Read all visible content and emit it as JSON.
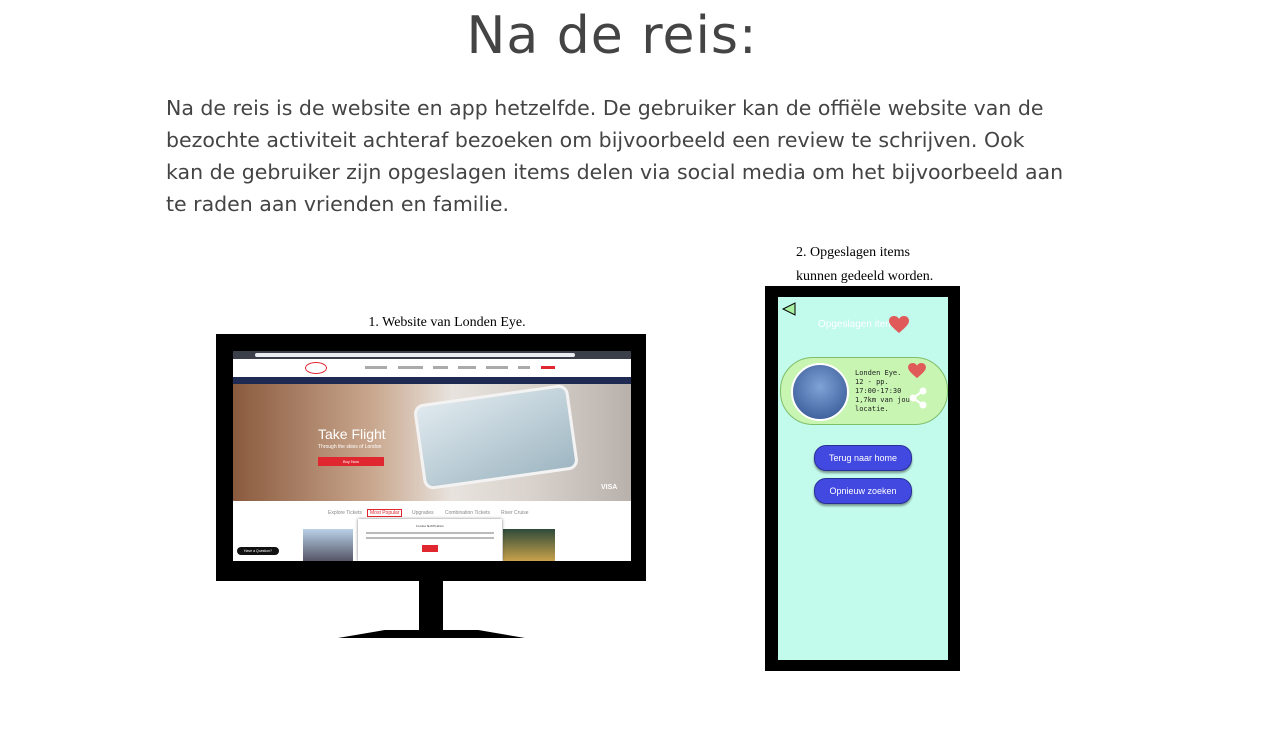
{
  "page": {
    "title": "Na de reis:",
    "intro": "Na de reis is de website en app hetzelfde. De gebruiker kan de offiële website van de bezochte activiteit achteraf bezoeken om bijvoorbeeld een review te schrijven. Ook kan de gebruiker zijn opgeslagen items delen via social media om het bijvoorbeeld aan te raden aan vrienden en familie."
  },
  "website": {
    "caption": "1. Website van Londen Eye.",
    "hero_title": "Take Flight",
    "hero_subtitle": "Through the skies of London",
    "hero_button": "Buy Now",
    "brand": "VISA",
    "tabs": [
      "Explore Tickets",
      "Most Popular",
      "Upgrades",
      "Combination Tickets",
      "River Cruise"
    ],
    "active_tab": "Most Popular",
    "cookie_title": "Cookie Notification",
    "chat_label": "Have a Question?"
  },
  "app": {
    "caption_line1": "2. Opgeslagen items",
    "caption_line2": "kunnen gedeeld worden.",
    "screen_title": "Opgeslagen items",
    "item": {
      "name": "Londen Eye.",
      "age": "12 - pp.",
      "time": "17:00-17:30",
      "distance": "1,7km van jou locatie."
    },
    "button_home": "Terug naar home",
    "button_search": "Opnieuw zoeken",
    "colors": {
      "screen": "#c2faec",
      "card": "#c8f5b2",
      "button": "#4249e0",
      "heart": "#e05a5a"
    }
  }
}
